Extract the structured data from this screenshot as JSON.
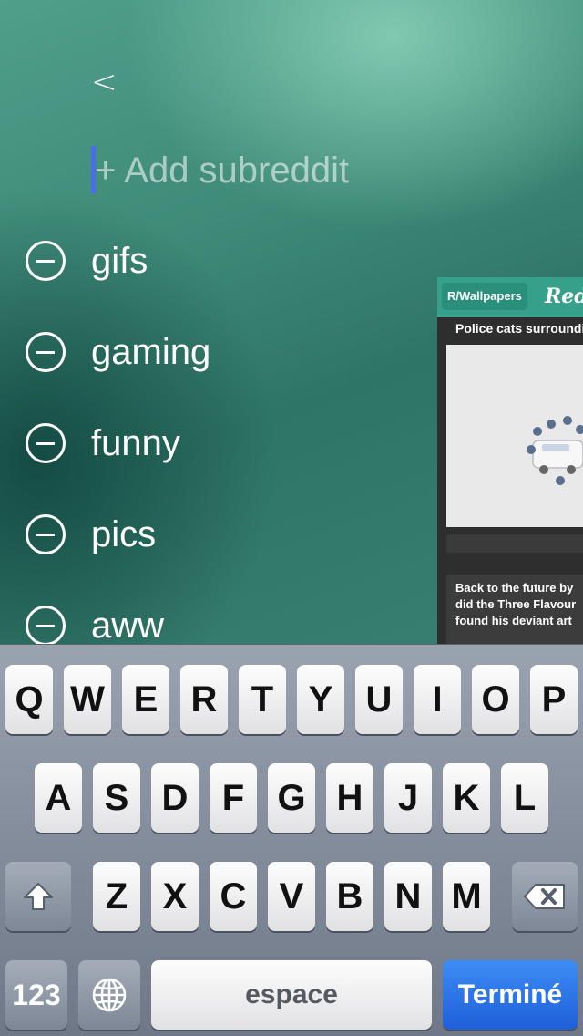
{
  "nav": {
    "back_label": "<"
  },
  "add_subreddit": {
    "placeholder": "+ Add subreddit",
    "value": ""
  },
  "subreddits": [
    {
      "name": "gifs"
    },
    {
      "name": "gaming"
    },
    {
      "name": "funny"
    },
    {
      "name": "pics"
    },
    {
      "name": "aww"
    }
  ],
  "preview": {
    "tab_label": "R/Wallpapers",
    "logo_text": "Red",
    "post1_title": "Police cats surroundi",
    "post2_lines": [
      "Back to the future by",
      "did the Three Flavour",
      "found his deviant art"
    ]
  },
  "keyboard": {
    "row1": [
      "Q",
      "W",
      "E",
      "R",
      "T",
      "Y",
      "U",
      "I",
      "O",
      "P"
    ],
    "row2": [
      "A",
      "S",
      "D",
      "F",
      "G",
      "H",
      "J",
      "K",
      "L"
    ],
    "row3": [
      "Z",
      "X",
      "C",
      "V",
      "B",
      "N",
      "M"
    ],
    "numbers_label": "123",
    "space_label": "espace",
    "done_label": "Terminé",
    "icons": {
      "shift": "shift-icon",
      "delete": "delete-icon",
      "globe": "globe-icon"
    }
  },
  "colors": {
    "cursor": "#4a6cf0",
    "accent_green": "#36a08a",
    "done_blue": "#2a72e6"
  }
}
